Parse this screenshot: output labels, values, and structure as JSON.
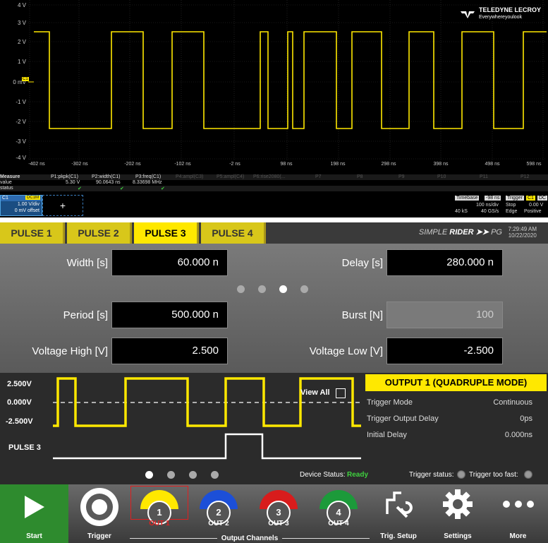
{
  "scope": {
    "y_ticks": [
      "4 V",
      "3 V",
      "2 V",
      "1 V",
      "0 mV",
      "-1 V",
      "-2 V",
      "-3 V",
      "-4 V"
    ],
    "x_ticks": [
      "-402 ns",
      "-302 ns",
      "-202 ns",
      "-102 ns",
      "-2 ns",
      "98 ns",
      "198 ns",
      "298 ns",
      "398 ns",
      "498 ns",
      "598 ns"
    ],
    "logo_line1": "TELEDYNE LECROY",
    "logo_line2": "Everywhereyoulook",
    "channel_marker": "C1",
    "measure": {
      "label_measure": "Measure",
      "label_value": "value",
      "label_status": "status",
      "p1_name": "P1:pkpk(C1)",
      "p1_value": "5.30 V",
      "p2_name": "P2:width(C1)",
      "p2_value": "90.0643 ns",
      "p3_name": "P3:freq(C1)",
      "p3_value": "8.33698 MHz",
      "p4_name": "P4:ampl(C3)",
      "p5_name": "P5:ampl(C4)",
      "p6_name": "P6:rise2080(...",
      "p7_name": "P7",
      "p8_name": "P8",
      "p9_name": "P9",
      "p10_name": "P10",
      "p11_name": "P11",
      "p12_name": "P12"
    },
    "c1": {
      "name": "C1",
      "coupling": "DC1M",
      "scale": "1.00 V/div",
      "offset": "0 mV offset"
    },
    "add_label": "+",
    "timebase": {
      "label": "Timebase",
      "value": "-98 ns",
      "rate": "100 ns/div",
      "samples": "40 kS",
      "srate": "40 GS/s"
    },
    "trigger": {
      "label": "Trigger",
      "chan": "C1",
      "coupling": "DC",
      "mode": "Stop",
      "level": "0.00 V",
      "type": "Edge",
      "slope": "Positive"
    }
  },
  "pulse_tabs": [
    "PULSE 1",
    "PULSE 2",
    "PULSE 3",
    "PULSE 4"
  ],
  "brand": {
    "simple": "SIMPLE",
    "rider": "RIDER",
    "pg": "PG",
    "time": "7:29:49 AM",
    "date": "10/22/2020"
  },
  "params": {
    "width_label": "Width [s]",
    "width_value": "60.000 n",
    "delay_label": "Delay [s]",
    "delay_value": "280.000 n",
    "period_label": "Period [s]",
    "period_value": "500.000 n",
    "burst_label": "Burst [N]",
    "burst_value": "100",
    "vhigh_label": "Voltage High [V]",
    "vhigh_value": "2.500",
    "vlow_label": "Voltage Low [V]",
    "vlow_value": "-2.500"
  },
  "wave": {
    "v_high": "2.500V",
    "v_zero": "0.000V",
    "v_low": "-2.500V",
    "pulse_label": "PULSE 3",
    "view_all": "View All"
  },
  "output": {
    "title": "OUTPUT 1 (QUADRUPLE MODE)",
    "rows": [
      {
        "label": "Trigger Mode",
        "value": "Continuous"
      },
      {
        "label": "Trigger Output Delay",
        "value": "0ps"
      },
      {
        "label": "Initial Delay",
        "value": "0.000ns"
      }
    ]
  },
  "status": {
    "device_label": "Device Status:",
    "device_value": "Ready",
    "trigger_status": "Trigger status:",
    "trigger_fast": "Trigger too fast:"
  },
  "toolbar": {
    "start": "Start",
    "trigger": "Trigger",
    "out1_num": "1",
    "out1": "OUT 1",
    "out2_num": "2",
    "out2": "OUT 2",
    "out3_num": "3",
    "out3": "OUT 3",
    "out4_num": "4",
    "out4": "OUT 4",
    "output_channels": "Output Channels",
    "trig_setup": "Trig. Setup",
    "settings": "Settings",
    "more": "More"
  },
  "colors": {
    "accent": "#ffe800",
    "ready": "#3fd13f",
    "out1": "#ffe800",
    "out2": "#1c4fd8",
    "out3": "#d81c1c",
    "out4": "#1c9a3a"
  }
}
